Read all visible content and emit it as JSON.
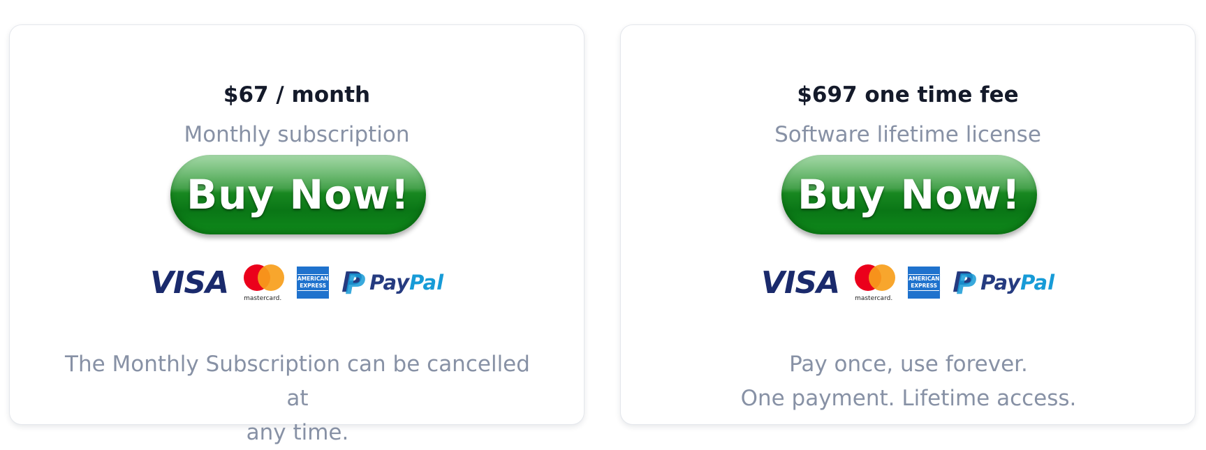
{
  "plans": [
    {
      "price": "$67 / month",
      "subtitle": "Monthly subscription",
      "button_label": "Buy Now!",
      "note_lines": [
        "The Monthly Subscription can be cancelled at",
        "any time."
      ]
    },
    {
      "price": "$697 one time fee",
      "subtitle": "Software lifetime license",
      "button_label": "Buy Now!",
      "note_lines": [
        "Pay once, use forever.",
        "One payment. Lifetime access."
      ]
    }
  ],
  "payment_logos": {
    "visa": "VISA",
    "mastercard": "mastercard.",
    "amex_top": "AMERICAN",
    "amex_bottom": "EXPRESS",
    "paypal_mark": "P",
    "paypal_pay": "Pay",
    "paypal_pal": "Pal"
  },
  "colors": {
    "button_green": "#0a7616",
    "text_dark": "#141a2a",
    "text_muted": "#8791a5",
    "visa_blue": "#1a2a6c",
    "mastercard_red": "#eb001b",
    "mastercard_orange": "#f79e1b",
    "amex_blue": "#1f72cd",
    "paypal_dark": "#253b80",
    "paypal_light": "#179bd7"
  }
}
